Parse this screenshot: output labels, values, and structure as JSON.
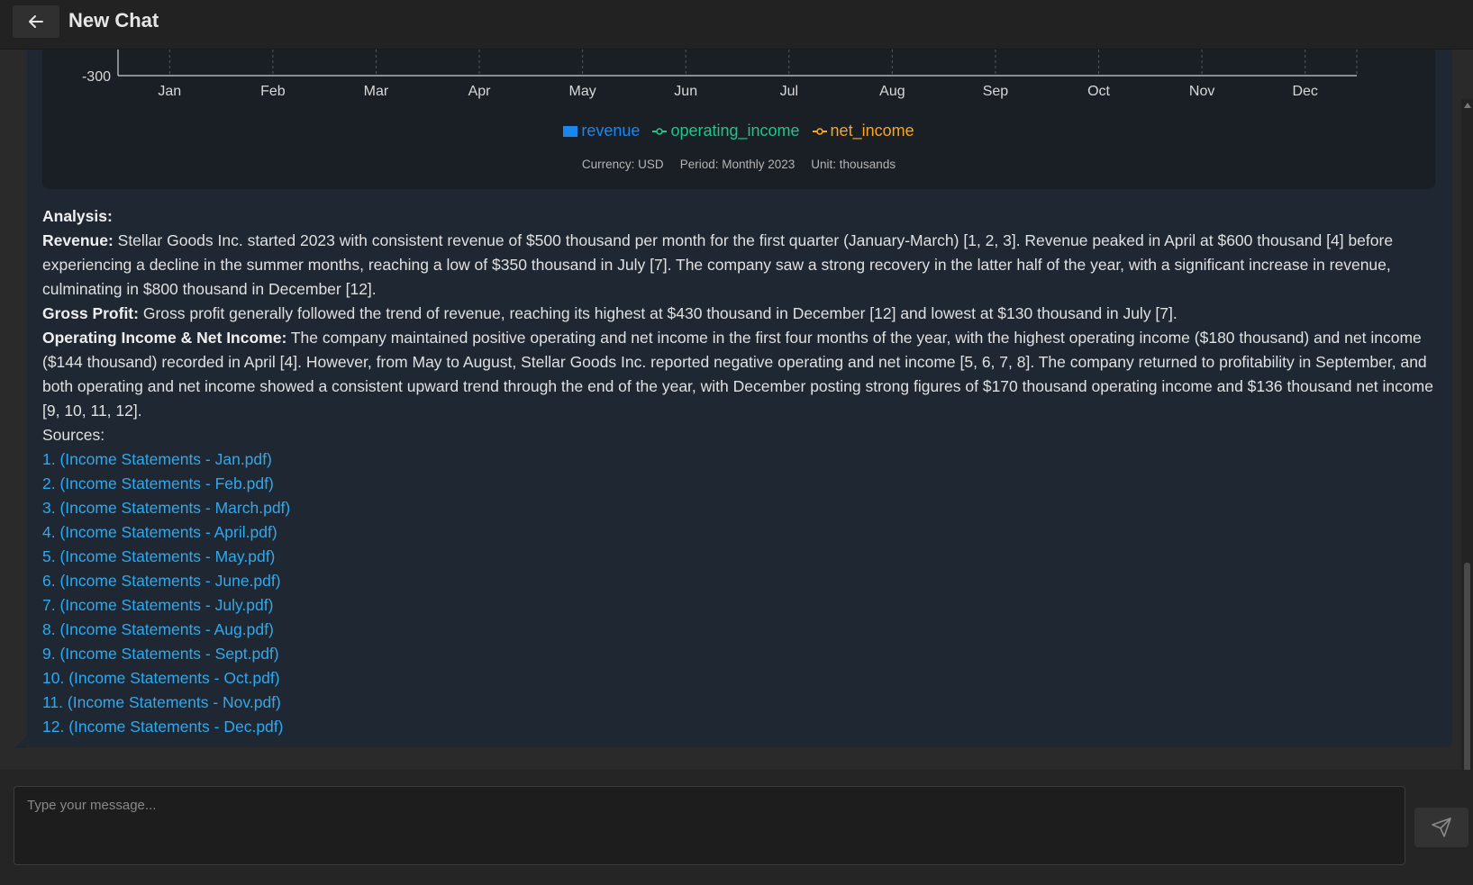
{
  "header": {
    "title": "New Chat",
    "back_icon": "arrow-left-icon"
  },
  "chart_data": {
    "type": "bar",
    "categories": [
      "Jan",
      "Feb",
      "Mar",
      "Apr",
      "May",
      "Jun",
      "Jul",
      "Aug",
      "Sep",
      "Oct",
      "Nov",
      "Dec"
    ],
    "visible_y_tick": "-300",
    "series": [
      {
        "name": "revenue",
        "kind": "bar",
        "color": "#1a86f0"
      },
      {
        "name": "operating_income",
        "kind": "line",
        "color": "#21c48a"
      },
      {
        "name": "net_income",
        "kind": "line",
        "color": "#f5a623"
      }
    ]
  },
  "chart_footer": {
    "currency": "Currency: USD",
    "period": "Period: Monthly 2023",
    "unit": "Unit: thousands"
  },
  "analysis": {
    "heading": "Analysis:",
    "revenue_label": "Revenue:",
    "revenue_text": " Stellar Goods Inc. started 2023 with consistent revenue of $500 thousand per month for the first quarter (January-March) [1, 2, 3]. Revenue peaked in April at $600 thousand [4] before experiencing a decline in the summer months, reaching a low of $350 thousand in July [7]. The company saw a strong recovery in the latter half of the year, with a significant increase in revenue, culminating in $800 thousand in December [12].",
    "gross_label": "Gross Profit:",
    "gross_text": " Gross profit generally followed the trend of revenue, reaching its highest at $430 thousand in December [12] and lowest at $130 thousand in July [7].",
    "opinc_label": "Operating Income & Net Income:",
    "opinc_text": " The company maintained positive operating and net income in the first four months of the year, with the highest operating income ($180 thousand) and net income ($144 thousand) recorded in April [4]. However, from May to August, Stellar Goods Inc. reported negative operating and net income [5, 6, 7, 8]. The company returned to profitability in September, and both operating and net income showed a consistent upward trend through the end of the year, with December posting strong figures of $170 thousand operating income and $136 thousand net income [9, 10, 11, 12].",
    "sources_label": "Sources:",
    "sources": [
      "1. (Income Statements - Jan.pdf)",
      "2. (Income Statements - Feb.pdf)",
      "3. (Income Statements - March.pdf)",
      "4. (Income Statements - April.pdf)",
      "5. (Income Statements - May.pdf)",
      "6. (Income Statements - June.pdf)",
      "7. (Income Statements - July.pdf)",
      "8. (Income Statements - Aug.pdf)",
      "9. (Income Statements - Sept.pdf)",
      "10. (Income Statements - Oct.pdf)",
      "11. (Income Statements - Nov.pdf)",
      "12. (Income Statements - Dec.pdf)"
    ]
  },
  "composer": {
    "placeholder": "Type your message...",
    "send_icon": "send-icon"
  }
}
